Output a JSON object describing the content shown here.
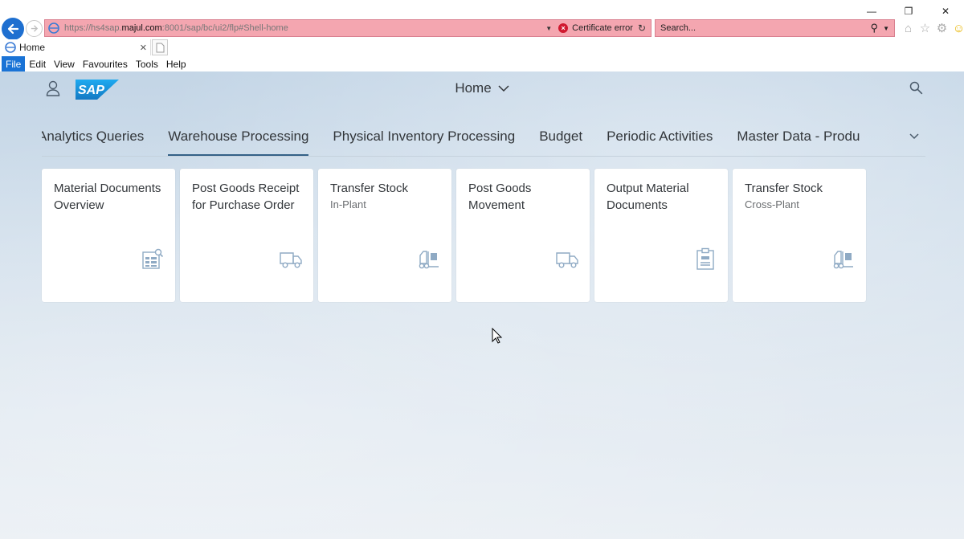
{
  "browser": {
    "url_prefix": "https://hs4sap.",
    "url_host": "majul.com",
    "url_suffix": ":8001/sap/bc/ui2/flp#Shell-home",
    "cert_error": "Certificate error",
    "search_placeholder": "Search...",
    "tab_label": "Home",
    "menu": [
      "File",
      "Edit",
      "View",
      "Favourites",
      "Tools",
      "Help"
    ],
    "colors": {
      "address_bar_error": "#f4a6b0",
      "back_button": "#1e6fd0",
      "menu_active": "#1a73d6"
    }
  },
  "shell": {
    "title": "Home",
    "anchor_items": [
      "Analytics Queries",
      "Warehouse Processing",
      "Physical Inventory Processing",
      "Budget",
      "Periodic Activities",
      "Master Data - Produ"
    ],
    "selected_anchor": "Warehouse Processing",
    "colors": {
      "sap_blue": "#1a9ad9",
      "selected_underline": "#346187",
      "icon_color": "#8faac4"
    }
  },
  "tiles": [
    {
      "title": "Material Documents Overview",
      "subtitle": "",
      "icon": "document-analysis-icon"
    },
    {
      "title": "Post Goods Receipt for Purchase Order",
      "subtitle": "",
      "icon": "truck-icon"
    },
    {
      "title": "Transfer Stock",
      "subtitle": "In-Plant",
      "icon": "forklift-icon"
    },
    {
      "title": "Post Goods Movement",
      "subtitle": "",
      "icon": "truck-icon"
    },
    {
      "title": "Output Material Documents",
      "subtitle": "",
      "icon": "clipboard-icon"
    },
    {
      "title": "Transfer Stock",
      "subtitle": "Cross-Plant",
      "icon": "forklift-icon"
    }
  ]
}
